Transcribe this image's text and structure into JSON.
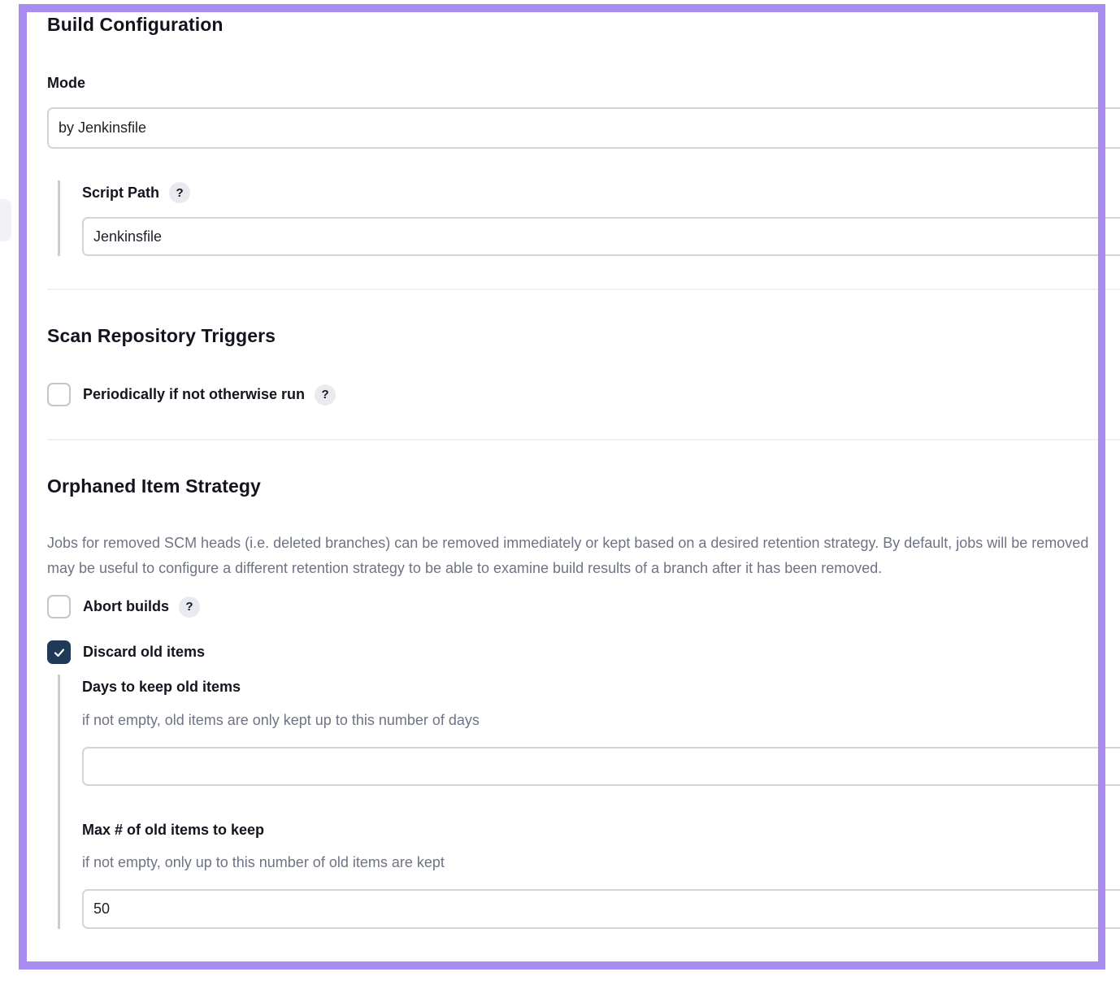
{
  "build_config": {
    "title": "Build Configuration",
    "mode_label": "Mode",
    "mode_value": "by Jenkinsfile",
    "script_path_label": "Script Path",
    "script_path_value": "Jenkinsfile",
    "help_glyph": "?"
  },
  "scan_triggers": {
    "title": "Scan Repository Triggers",
    "periodic_label": "Periodically if not otherwise run",
    "periodic_checked": false
  },
  "orphaned": {
    "title": "Orphaned Item Strategy",
    "description_line1": "Jobs for removed SCM heads (i.e. deleted branches) can be removed immediately or kept based on a desired retention strategy. By default, jobs will be removed",
    "description_line2": "may be useful to configure a different retention strategy to be able to examine build results of a branch after it has been removed.",
    "abort_label": "Abort builds",
    "abort_checked": false,
    "discard_label": "Discard old items",
    "discard_checked": true,
    "days_label": "Days to keep old items",
    "days_hint": "if not empty, old items are only kept up to this number of days",
    "days_value": "",
    "max_label": "Max # of old items to keep",
    "max_hint": "if not empty, only up to this number of old items are kept",
    "max_value": "50"
  },
  "colors": {
    "frame": "#a78bf0",
    "checked_box": "#1f3a57"
  },
  "icons": {
    "help": "help-icon",
    "check": "check-icon"
  }
}
